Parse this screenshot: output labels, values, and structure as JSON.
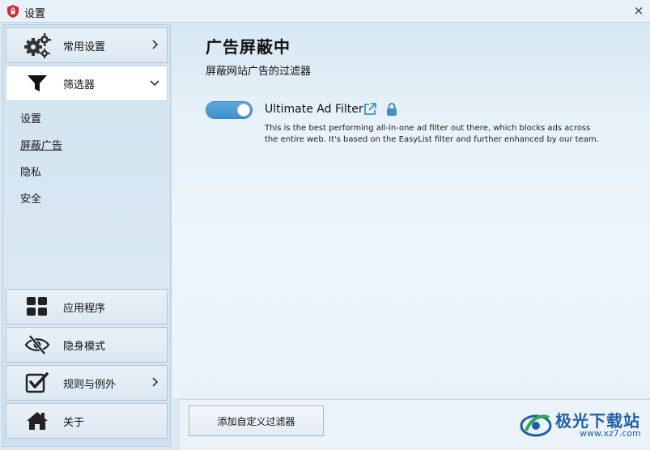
{
  "window": {
    "title": "设置",
    "close_glyph": "×"
  },
  "sidebar": {
    "nav_top": [
      {
        "label": "常用设置",
        "icon": "gears-icon",
        "chevron": "right"
      },
      {
        "label": "筛选器",
        "icon": "funnel-icon",
        "chevron": "down",
        "active": true
      }
    ],
    "sub_items": [
      {
        "label": "设置"
      },
      {
        "label": "屏蔽广告",
        "current": true
      },
      {
        "label": "隐私"
      },
      {
        "label": "安全"
      }
    ],
    "nav_bottom": [
      {
        "label": "应用程序",
        "icon": "apps-grid-icon"
      },
      {
        "label": "隐身模式",
        "icon": "stealth-eye-icon"
      },
      {
        "label": "规则与例外",
        "icon": "checkbox-icon",
        "chevron": "right"
      },
      {
        "label": "关于",
        "icon": "home-icon"
      }
    ]
  },
  "main": {
    "title": "广告屏蔽中",
    "subtitle": "屏蔽网站广告的过滤器",
    "filter": {
      "name": "Ultimate Ad Filter",
      "enabled": true,
      "description": "This is the best performing all-in-one ad filter out there, which blocks ads across the entire web. It's based on the EasyList filter and further enhanced by our team."
    }
  },
  "footer": {
    "add_button_label": "添加自定义过滤器"
  },
  "watermark": {
    "text": "极光下载站",
    "sub": "www.xz7.com"
  },
  "colors": {
    "accent": "#3f8fca",
    "watermark": "#1f5fa6",
    "app_icon": "#d9262c"
  }
}
